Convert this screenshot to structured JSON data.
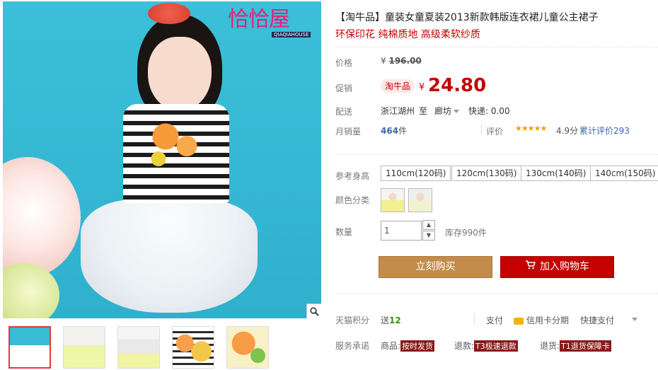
{
  "gallery": {
    "logo_main": "恰恰屋",
    "logo_sub": "QIAQIAHOUSE",
    "zoom_icon": "magnifier-icon"
  },
  "product": {
    "title": "【淘牛品】童装女童夏装2013新款韩版连衣裙儿童公主裙子",
    "subtitle": "环保印花 纯棉质地 高级柔软纱质"
  },
  "price": {
    "label": "价格",
    "currency": "¥",
    "original": "196.00"
  },
  "promo": {
    "label": "促销",
    "badge": "淘牛品",
    "currency": "¥",
    "price": "24.80"
  },
  "shipping": {
    "label": "配送",
    "from": "浙江湖州",
    "to_word": "至",
    "to": "廊坊",
    "fee": "快递: 0.00"
  },
  "sales": {
    "label": "月销量",
    "count": "464",
    "unit": "件",
    "review_label": "评价",
    "stars": "★★★★★",
    "rating": "4.9分",
    "cumulative": "累计评价293"
  },
  "size": {
    "label": "参考身高",
    "options": [
      "110cm(120码)",
      "120cm(130码)",
      "130cm(140码)",
      "140cm(150码)"
    ]
  },
  "color": {
    "label": "颜色分类"
  },
  "quantity": {
    "label": "数量",
    "value": "1",
    "up": "▲",
    "down": "▼",
    "stock": "库存990件"
  },
  "actions": {
    "buy": "立刻购买",
    "cart": "加入购物车"
  },
  "points": {
    "label": "天猫积分",
    "prefix": "送",
    "value": "12"
  },
  "payment": {
    "label": "支付",
    "credit": "信用卡分期",
    "quick": "快捷支付"
  },
  "service": {
    "label": "服务承诺",
    "goods_label": "商品:",
    "goods_tag": "按时发货",
    "refund_label": "退款:",
    "refund_tag": "T3极速退款",
    "return_label": "退货:",
    "return_tag": "T1退货保障卡"
  }
}
